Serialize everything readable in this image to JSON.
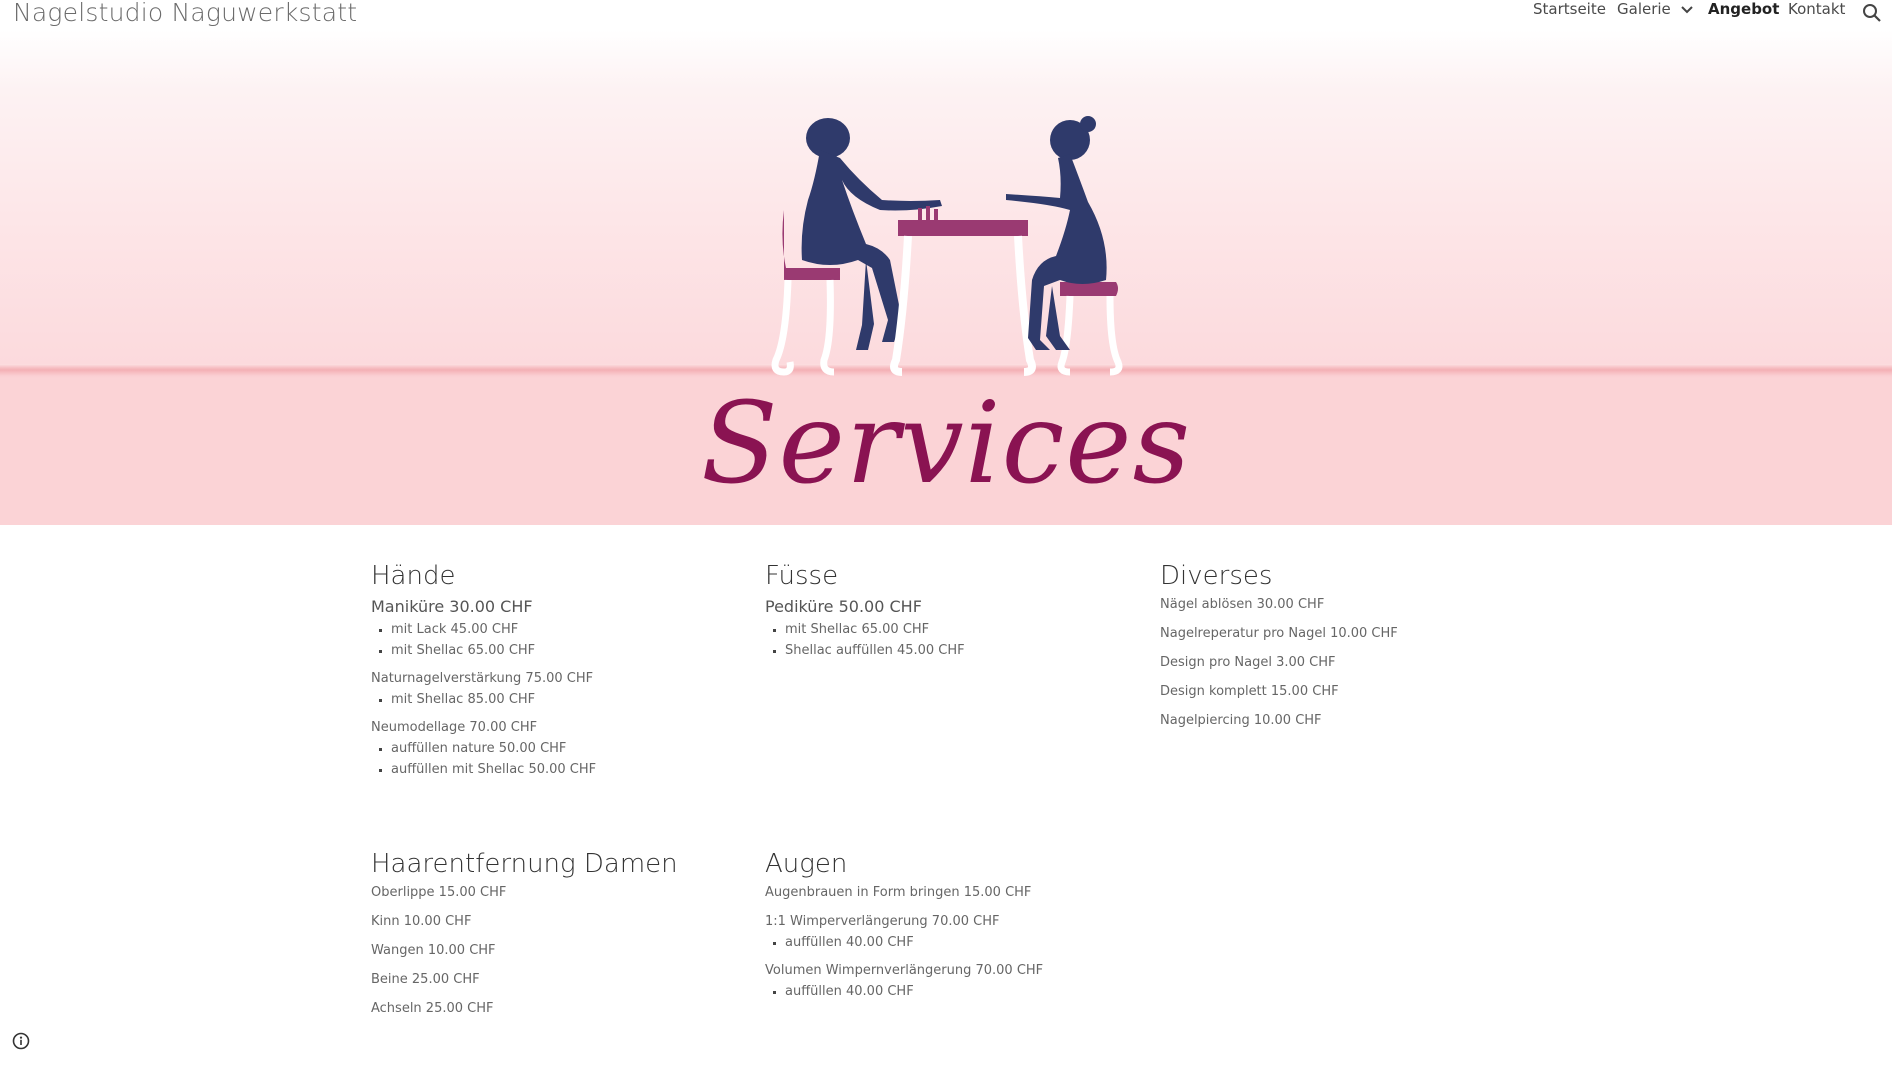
{
  "site": {
    "title": "Nagelstudio Naguwerkstatt"
  },
  "nav": {
    "items": [
      {
        "label": "Startseite"
      },
      {
        "label": "Galerie"
      },
      {
        "label": "Angebot"
      },
      {
        "label": "Kontakt"
      }
    ],
    "active": "Angebot"
  },
  "hero": {
    "title": "Services"
  },
  "colors": {
    "accent": "#8a1352",
    "silhouette": "#2f3a6b",
    "chair": "#9a3a72",
    "hero_pink": "#fbd3d6"
  },
  "sections": {
    "haende": {
      "title": "Hände",
      "manikuere": "Maniküre 30.00 CHF",
      "manikuere_items": [
        "mit Lack 45.00 CHF",
        "mit Shellac 65.00 CHF"
      ],
      "natur": "Naturnagelverstärkung 75.00 CHF",
      "natur_items": [
        "mit Shellac 85.00 CHF"
      ],
      "neu": "Neumodellage 70.00 CHF",
      "neu_items": [
        "auffüllen nature 50.00 CHF",
        "auffüllen mit Shellac 50.00 CHF"
      ]
    },
    "fuesse": {
      "title": "Füsse",
      "pedikuere": "Pediküre 50.00 CHF",
      "items": [
        "mit Shellac 65.00 CHF",
        "Shellac auffüllen 45.00 CHF"
      ]
    },
    "diverses": {
      "title": "Diverses",
      "items": [
        "Nägel ablösen 30.00 CHF",
        "Nagelreperatur pro Nagel 10.00 CHF",
        "Design pro Nagel 3.00 CHF",
        "Design komplett 15.00 CHF",
        "Nagelpiercing 10.00 CHF"
      ]
    },
    "haarentfernung": {
      "title": "Haarentfernung Damen",
      "items": [
        "Oberlippe 15.00 CHF",
        "Kinn 10.00 CHF",
        "Wangen 10.00 CHF",
        "Beine 25.00 CHF",
        "Achseln 25.00 CHF"
      ]
    },
    "augen": {
      "title": "Augen",
      "brauen": "Augenbrauen in Form bringen 15.00 CHF",
      "wimper": "1:1 Wimperverlängerung  70.00 CHF",
      "wimper_items": [
        "auffüllen 40.00 CHF"
      ],
      "volumen": "Volumen Wimpernverlängerung 70.00 CHF",
      "volumen_items": [
        "auffüllen 40.00 CHF"
      ]
    }
  }
}
